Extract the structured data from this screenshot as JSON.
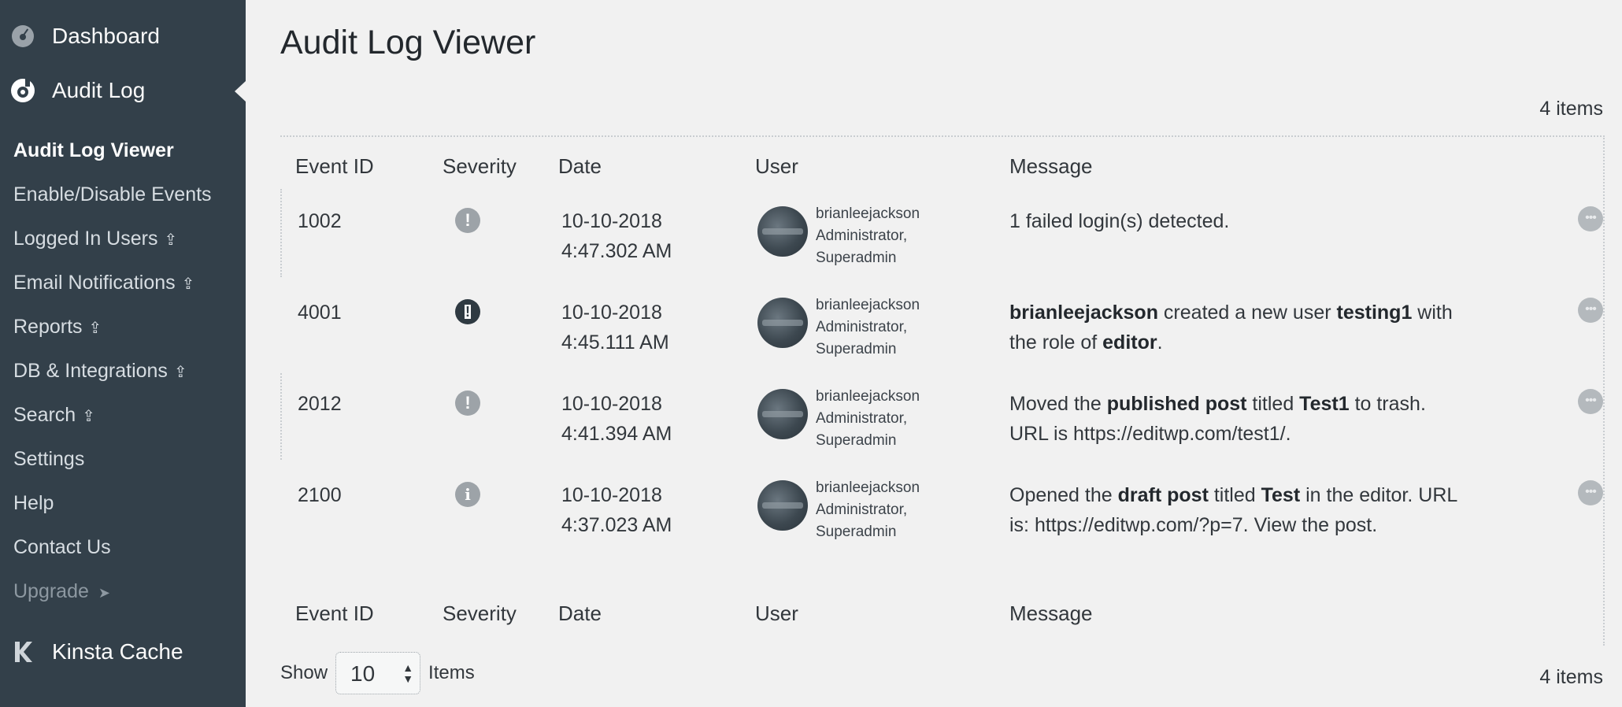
{
  "sidebar": {
    "dashboard": "Dashboard",
    "audit_log": "Audit Log",
    "submenu": [
      {
        "label": "Audit Log Viewer",
        "current": true
      },
      {
        "label": "Enable/Disable Events"
      },
      {
        "label": "Logged In Users",
        "upgrade_icon": "⇪"
      },
      {
        "label": "Email Notifications",
        "upgrade_icon": "⇪"
      },
      {
        "label": "Reports",
        "upgrade_icon": "⇪"
      },
      {
        "label": "DB & Integrations",
        "upgrade_icon": "⇪"
      },
      {
        "label": "Search",
        "upgrade_icon": "⇪"
      },
      {
        "label": "Settings"
      },
      {
        "label": "Help"
      },
      {
        "label": "Contact Us"
      },
      {
        "label": "Upgrade",
        "arrow": "➤"
      }
    ],
    "kinsta": "Kinsta Cache"
  },
  "page": {
    "title": "Audit Log Viewer",
    "items_count": "4 items"
  },
  "table": {
    "headers": [
      "Event ID",
      "Severity",
      "Date",
      "User",
      "Message"
    ],
    "rows": [
      {
        "event_id": "1002",
        "severity": "medium",
        "date": "10-10-2018",
        "time": "4:47.302 AM",
        "user": {
          "name": "brianleejackson",
          "role1": "Administrator,",
          "role2": "Superadmin"
        },
        "message_html": "1 failed login(s) detected."
      },
      {
        "event_id": "4001",
        "severity": "high",
        "date": "10-10-2018",
        "time": "4:45.111 AM",
        "user": {
          "name": "brianleejackson",
          "role1": "Administrator,",
          "role2": "Superadmin"
        },
        "message_html": "<b>brianleejackson</b> created a new user <b>testing1</b> with the role of <b>editor</b>."
      },
      {
        "event_id": "2012",
        "severity": "medium",
        "date": "10-10-2018",
        "time": "4:41.394 AM",
        "user": {
          "name": "brianleejackson",
          "role1": "Administrator,",
          "role2": "Superadmin"
        },
        "message_html": "Moved the <b>published post</b> titled <b>Test1</b> to trash. URL is https://editwp.com/test1/."
      },
      {
        "event_id": "2100",
        "severity": "info",
        "date": "10-10-2018",
        "time": "4:37.023 AM",
        "user": {
          "name": "brianleejackson",
          "role1": "Administrator,",
          "role2": "Superadmin"
        },
        "message_html": "Opened the <b>draft post</b> titled <b>Test</b> in the editor. URL is: https://editwp.com/?p=7. View the post."
      }
    ]
  },
  "pagination": {
    "show_label": "Show",
    "per_page": "10",
    "items_label": "Items"
  }
}
